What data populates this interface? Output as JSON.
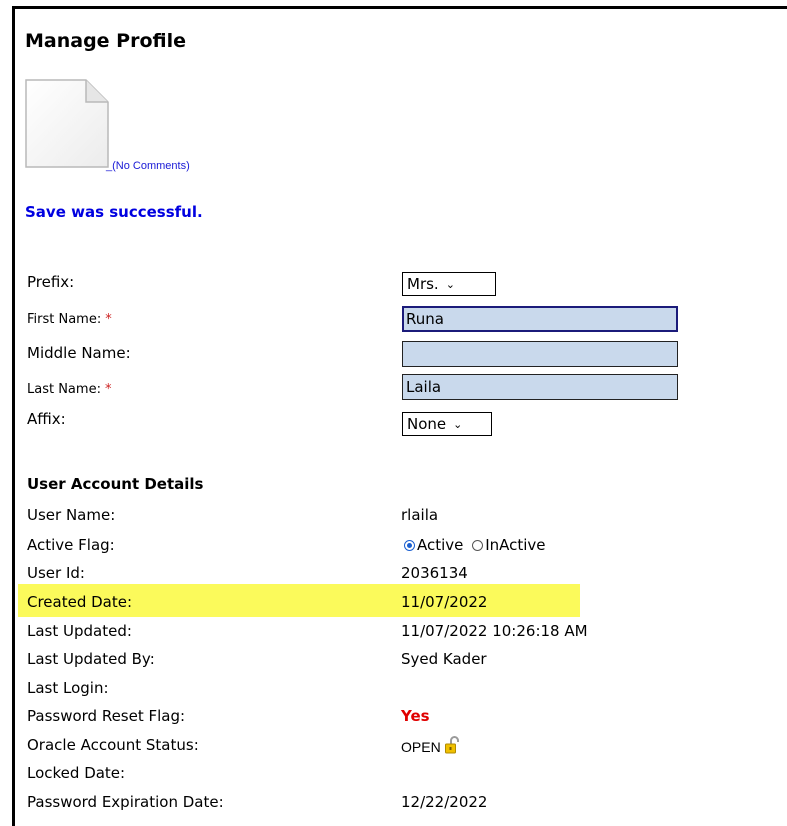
{
  "page": {
    "title": "Manage Profile"
  },
  "comments": {
    "link_text": "_(No Comments)"
  },
  "status": {
    "message": "Save was successful."
  },
  "form": {
    "prefix": {
      "label": "Prefix:",
      "value": "Mrs."
    },
    "first_name": {
      "label": "First Name:",
      "required_mark": "*",
      "value": "Runa"
    },
    "middle_name": {
      "label": "Middle Name:",
      "value": ""
    },
    "last_name": {
      "label": "Last Name:",
      "required_mark": "*",
      "value": "Laila"
    },
    "affix": {
      "label": "Affix:",
      "value": "None"
    }
  },
  "account": {
    "heading": "User Account Details",
    "user_name": {
      "label": "User Name:",
      "value": "rlaila"
    },
    "active_flag": {
      "label": "Active Flag:",
      "options": [
        "Active",
        "InActive"
      ],
      "selected": "Active"
    },
    "user_id": {
      "label": "User Id:",
      "value": "2036134"
    },
    "created_date": {
      "label": "Created Date:",
      "value": "11/07/2022"
    },
    "last_updated": {
      "label": "Last Updated:",
      "value": "11/07/2022 10:26:18 AM"
    },
    "last_updated_by": {
      "label": "Last Updated By:",
      "value": "Syed Kader"
    },
    "last_login": {
      "label": "Last Login:",
      "value": ""
    },
    "password_reset_flag": {
      "label": "Password Reset Flag:",
      "value": "Yes"
    },
    "oracle_account_status": {
      "label": "Oracle Account Status:",
      "value": "OPEN",
      "icon": "unlocked-padlock-icon"
    },
    "locked_date": {
      "label": "Locked Date:",
      "value": ""
    },
    "password_expiration_date": {
      "label": "Password Expiration Date:",
      "value": "12/22/2022"
    }
  },
  "colors": {
    "highlight": "#fbfa5b",
    "success": "#0000e0",
    "required": "#cc2222",
    "reset_yes": "#e00000",
    "input_bg": "#c9d9ec"
  }
}
